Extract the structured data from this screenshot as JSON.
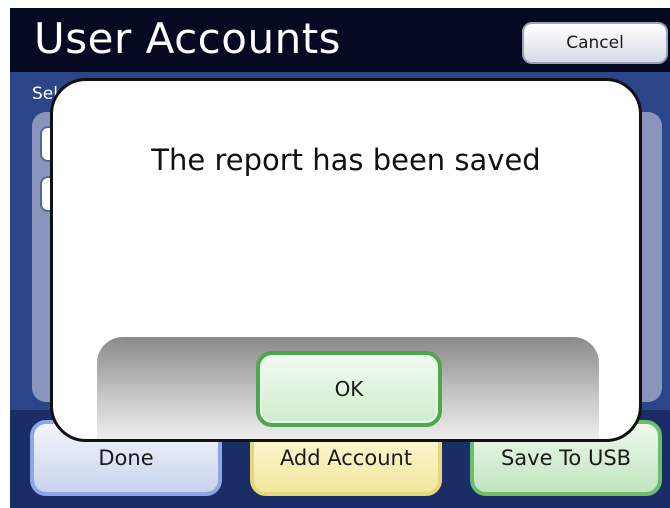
{
  "header": {
    "title": "User Accounts",
    "cancel_label": "Cancel"
  },
  "content": {
    "select_label_visible": "Sele"
  },
  "dialog": {
    "message": "The report has been saved",
    "ok_label": "OK"
  },
  "footer": {
    "done_label": "Done",
    "add_account_label": "Add Account",
    "save_usb_label": "Save To USB"
  },
  "colors": {
    "title_bar": "#050a22",
    "background": "#1b2d66",
    "done_accent": "#8fa6e6",
    "add_accent": "#e7d77a",
    "save_accent": "#6bbf6b",
    "ok_accent": "#4da84d"
  }
}
